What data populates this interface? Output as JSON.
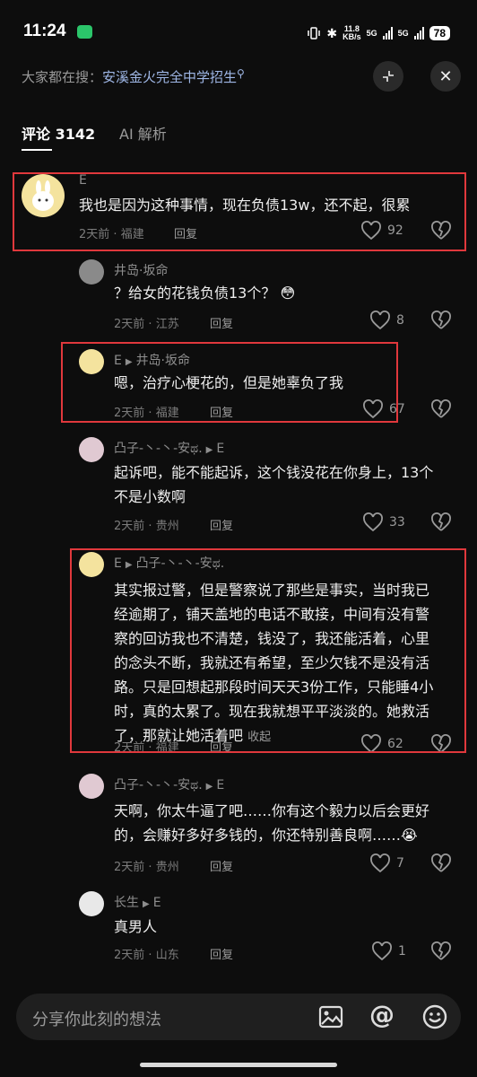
{
  "status": {
    "time": "11:24",
    "net_speed": "11.8",
    "net_unit": "KB/s",
    "sim1": "5G",
    "sim2": "5G",
    "battery": "78"
  },
  "search": {
    "prefix": "大家都在搜：",
    "query": "安溪金火完全中学招生"
  },
  "tabs": {
    "comments": "评论 3142",
    "ai": "AI 解析"
  },
  "comments": [
    {
      "author": "E",
      "reply_to": "",
      "text_lines": [
        "我也是因为这种事情，现在负债13w，还不起，很累"
      ],
      "time": "2天前",
      "location": "福建",
      "reply": "回复",
      "likes": "92",
      "highlighted": true
    },
    {
      "author": "井岛·坂命",
      "reply_to": "",
      "text_lines": [
        "？给女的花钱负债13个？"
      ],
      "emoji": "😳",
      "time": "2天前",
      "location": "江苏",
      "reply": "回复",
      "likes": "8",
      "highlighted": false
    },
    {
      "author": "E",
      "reply_to": "井岛·坂命",
      "text_lines": [
        "嗯，治疗心梗花的，但是她辜负了我"
      ],
      "time": "2天前",
      "location": "福建",
      "reply": "回复",
      "likes": "67",
      "highlighted": true
    },
    {
      "author": "凸子-丶-丶-安ಥ.",
      "reply_to": "E",
      "text_lines": [
        "起诉吧，能不能起诉，这个钱没花在你身上，13个",
        "不是小数啊"
      ],
      "time": "2天前",
      "location": "贵州",
      "reply": "回复",
      "likes": "33",
      "highlighted": false
    },
    {
      "author": "E",
      "reply_to": "凸子-丶-丶-安ಥ.",
      "text_lines": [
        "其实报过警，但是警察说了那些是事实，当时我已",
        "经逾期了，铺天盖地的电话不敢接，中间有没有警",
        "察的回访我也不清楚，钱没了，我还能活着，心里",
        "的念头不断，我就还有希望，至少欠钱不是没有活",
        "路。只是回想起那段时间天天3份工作，只能睡4小",
        "时，真的太累了。现在我就想平平淡淡的。她救活",
        "了，那就让她活着吧"
      ],
      "collapse": "收起",
      "time": "2天前",
      "location": "福建",
      "reply": "回复",
      "likes": "62",
      "highlighted": true
    },
    {
      "author": "凸子-丶-丶-安ಥ.",
      "reply_to": "E",
      "text_lines": [
        "天啊，你太牛逼了吧……你有这个毅力以后会更好",
        "的，会赚好多好多钱的，你还特别善良啊……"
      ],
      "emoji": "😭",
      "time": "2天前",
      "location": "贵州",
      "reply": "回复",
      "likes": "7",
      "highlighted": false
    },
    {
      "author": "长生",
      "reply_to": "E",
      "text_lines": [
        "真男人"
      ],
      "time": "2天前",
      "location": "山东",
      "reply": "回复",
      "likes": "1",
      "highlighted": false
    }
  ],
  "input": {
    "placeholder": "分享你此刻的想法"
  },
  "colors": {
    "highlight": "#e0383c",
    "background": "#0d0d0d"
  }
}
